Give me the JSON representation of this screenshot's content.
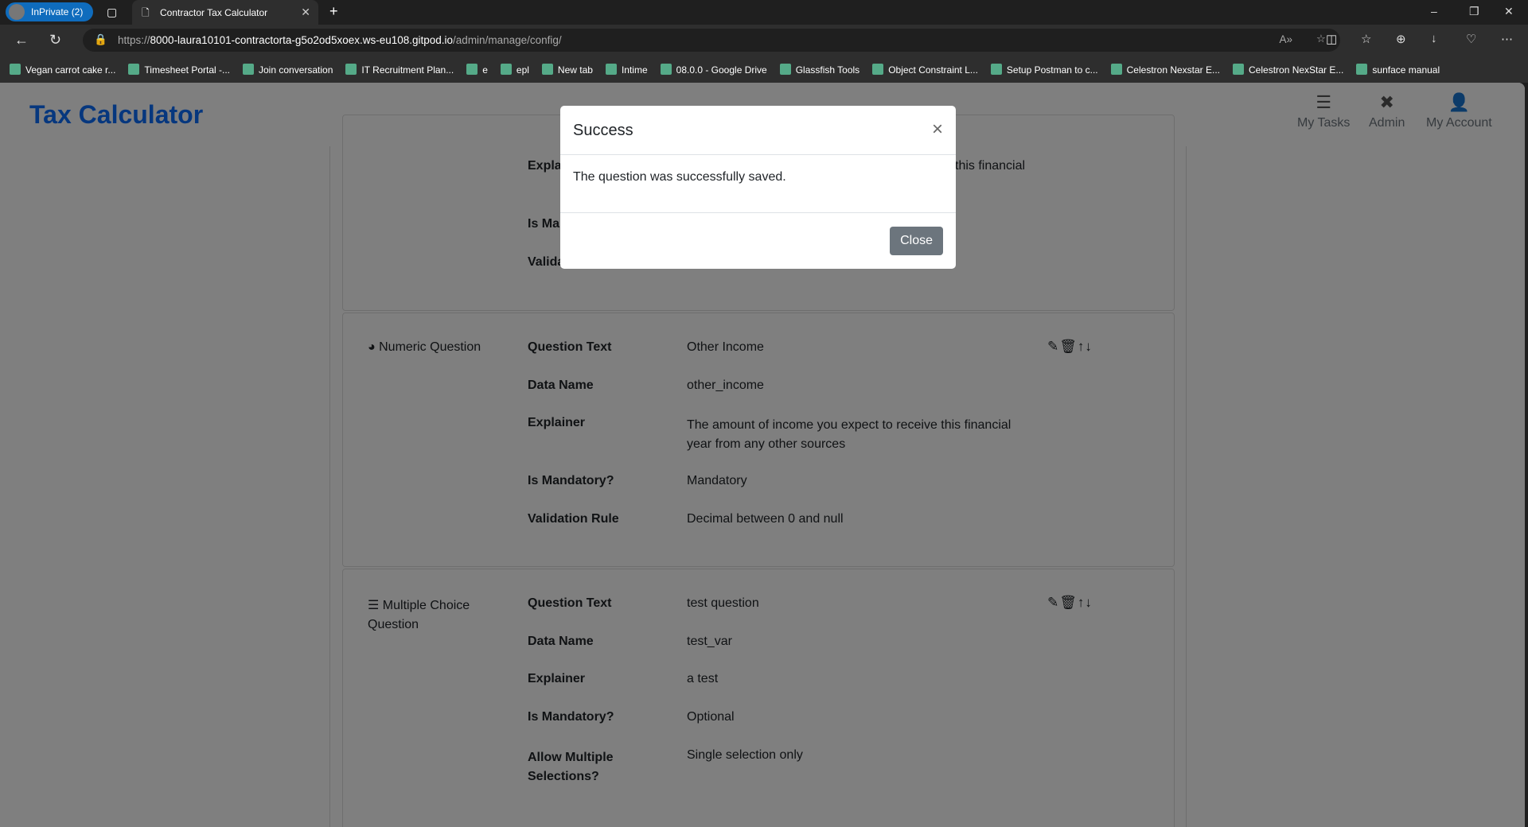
{
  "browser": {
    "profile": "InPrivate (2)",
    "tab_title": "Contractor Tax Calculator",
    "url_scheme": "https://",
    "url_host": "8000-laura10101-contractorta-g5o2od5xoex.ws-eu108.gitpod.io",
    "url_path": "/admin/manage/config/",
    "bookmarks": [
      "Vegan carrot cake r...",
      "Timesheet Portal -...",
      "Join conversation",
      "IT Recruitment Plan...",
      "e",
      "epl",
      "New tab",
      "Intime",
      "08.0.0 - Google Drive",
      "Glassfish Tools",
      "Object Constraint L...",
      "Setup Postman to c...",
      "Celestron Nexstar E...",
      "Celestron NexStar E...",
      "sunface manual"
    ]
  },
  "app": {
    "brand": "Tax Calculator",
    "nav": [
      {
        "label": "My Tasks",
        "icon": "tasks-icon"
      },
      {
        "label": "Admin",
        "icon": "tools-icon"
      },
      {
        "label": "My Account",
        "icon": "user-icon"
      }
    ]
  },
  "cards": [
    {
      "rows": [
        {
          "label": "Explainer",
          "value": "this financial"
        },
        {
          "label": "Is Mandatory?",
          "value": ""
        },
        {
          "label": "Validation Rule",
          "value": ""
        }
      ]
    },
    {
      "type": "Numeric Question",
      "icon": "calculator-icon",
      "rows": [
        {
          "label": "Question Text",
          "value": "Other Income"
        },
        {
          "label": "Data Name",
          "value": "other_income"
        },
        {
          "label": "Explainer",
          "value": "The amount of income you expect to receive this financial year from any other sources"
        },
        {
          "label": "Is Mandatory?",
          "value": "Mandatory"
        },
        {
          "label": "Validation Rule",
          "value": "Decimal between 0 and null"
        }
      ]
    },
    {
      "type": "Multiple Choice Question",
      "icon": "list-check-icon",
      "rows": [
        {
          "label": "Question Text",
          "value": "test question"
        },
        {
          "label": "Data Name",
          "value": "test_var"
        },
        {
          "label": "Explainer",
          "value": "a test"
        },
        {
          "label": "Is Mandatory?",
          "value": "Optional"
        },
        {
          "label": "Allow Multiple Selections?",
          "value": "Single selection only"
        }
      ]
    }
  ],
  "modal": {
    "title": "Success",
    "message": "The question was successfully saved.",
    "close_label": "Close"
  }
}
